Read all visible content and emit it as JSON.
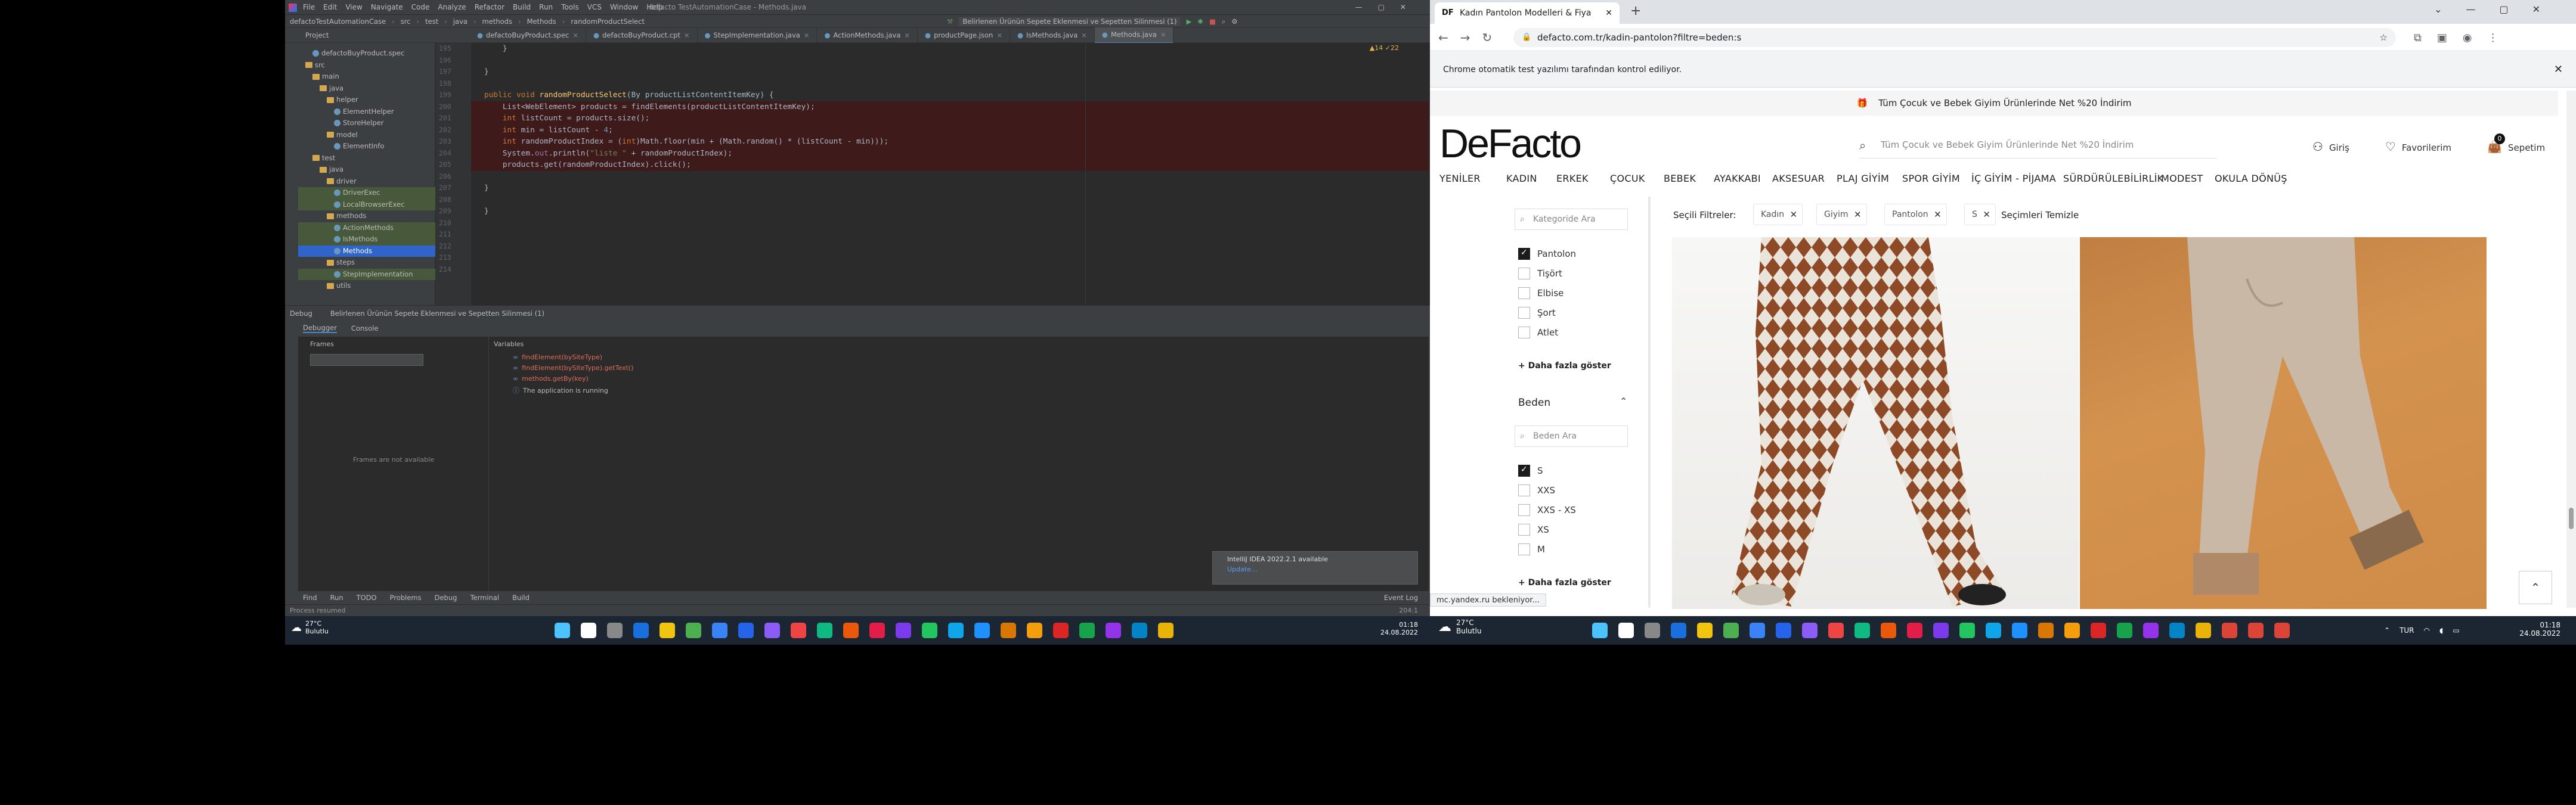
{
  "ide": {
    "menu": [
      "File",
      "Edit",
      "View",
      "Navigate",
      "Code",
      "Analyze",
      "Refactor",
      "Build",
      "Run",
      "Tools",
      "VCS",
      "Window",
      "Help"
    ],
    "window_title": "defacto TestAutomationCase - Methods.java",
    "breadcrumb": [
      "defactoTestAutomationCase",
      "src",
      "test",
      "java",
      "methods",
      "Methods",
      "randomProductSelect"
    ],
    "run_config": "Belirlenen Ürünün Sepete Eklenmesi ve Sepetten Silinmesi (1)",
    "tabs": [
      "defactoBuyProduct.spec",
      "defactoBuyProduct.cpt",
      "StepImplementation.java",
      "ActionMethods.java",
      "productPage.json",
      "IsMethods.java",
      "Methods.java"
    ],
    "project_label": "Project",
    "tree": [
      {
        "t": "defactoBuyProduct.spec",
        "d": 2,
        "i": "p"
      },
      {
        "t": "src",
        "d": 1,
        "i": "f"
      },
      {
        "t": "main",
        "d": 2,
        "i": "f"
      },
      {
        "t": "java",
        "d": 3,
        "i": "f"
      },
      {
        "t": "helper",
        "d": 4,
        "i": "f"
      },
      {
        "t": "ElementHelper",
        "d": 5,
        "i": "p"
      },
      {
        "t": "StoreHelper",
        "d": 5,
        "i": "p"
      },
      {
        "t": "model",
        "d": 4,
        "i": "f"
      },
      {
        "t": "ElementInfo",
        "d": 5,
        "i": "p"
      },
      {
        "t": "test",
        "d": 2,
        "i": "f"
      },
      {
        "t": "java",
        "d": 3,
        "i": "f"
      },
      {
        "t": "driver",
        "d": 4,
        "i": "f"
      },
      {
        "t": "DriverExec",
        "d": 5,
        "i": "p"
      },
      {
        "t": "LocalBrowserExec",
        "d": 5,
        "i": "p"
      },
      {
        "t": "methods",
        "d": 4,
        "i": "f"
      },
      {
        "t": "ActionMethods",
        "d": 5,
        "i": "p"
      },
      {
        "t": "IsMethods",
        "d": 5,
        "i": "p"
      },
      {
        "t": "Methods",
        "d": 5,
        "i": "p",
        "sel": true
      },
      {
        "t": "steps",
        "d": 4,
        "i": "f"
      },
      {
        "t": "StepImplementation",
        "d": 5,
        "i": "p"
      },
      {
        "t": "utils",
        "d": 4,
        "i": "f"
      }
    ],
    "line_numbers": [
      "195",
      "196",
      "197",
      "198",
      "199",
      "200",
      "201",
      "202",
      "203",
      "204",
      "205",
      "206",
      "207",
      "208",
      "209",
      "210",
      "211",
      "212",
      "213",
      "214"
    ],
    "code_lines": [
      "    }",
      "",
      "}",
      "",
      "public void randomProductSelect(By productListContentItemKey) {",
      "    List<WebElement> products = findElements(productListContentItemKey);",
      "    int listCount = products.size();",
      "    int min = listCount - 4;",
      "    int randomProductIndex = (int)Math.floor(min + (Math.random() * (listCount - min)));",
      "    System.out.println(\"liste \" + randomProductIndex);",
      "    products.get(randomProductIndex).click();",
      "",
      "}",
      "",
      "}",
      "",
      "",
      "",
      "",
      ""
    ],
    "warnings": "▲14 ✓22",
    "debug": {
      "title": "Debug",
      "config": "Belirlenen Ürünün Sepete Eklenmesi ve Sepetten Silinmesi (1)",
      "tabs": [
        "Debugger",
        "Console"
      ],
      "frames_label": "Frames",
      "variables_label": "Variables",
      "frames_empty": "Frames are not available",
      "variables": [
        "findElement(bySiteType)",
        "findElement(bySiteType).getText()",
        "methods.getBy(key)",
        "The application is running"
      ]
    },
    "notification": {
      "title": "IntelliJ IDEA 2022.2.1 available",
      "link": "Update..."
    },
    "status_tabs": [
      "Find",
      "Run",
      "TODO",
      "Problems",
      "Debug",
      "Terminal",
      "Build"
    ],
    "event_log": "Event Log",
    "status_msg": "Process resumed",
    "cursor_pos": "204:1"
  },
  "taskbar_left": {
    "temp": "27°C",
    "weather": "Bulutlu",
    "time": "01:18",
    "date": "24.08.2022"
  },
  "taskbar_right": {
    "temp": "27°C",
    "weather": "Bulutlu",
    "lang": "TUR",
    "time": "01:18",
    "date": "24.08.2022"
  },
  "browser": {
    "tab_title": "Kadın Pantolon Modelleri & Fiya",
    "url": "defacto.com.tr/kadin-pantolon?filtre=beden:s",
    "infobar": "Chrome otomatik test yazılımı tarafından kontrol ediliyor.",
    "promo": "Tüm Çocuk ve Bebek Giyim Ürünlerinde Net %20 İndirim",
    "logo": "DeFacto",
    "search_placeholder": "Tüm Çocuk ve Bebek Giyim Ürünlerinde Net %20 İndirim",
    "login": "Giriş",
    "favorites": "Favorilerim",
    "cart": "Sepetim",
    "cart_count": "0",
    "nav": [
      "YENİLER",
      "KADIN",
      "ERKEK",
      "ÇOCUK",
      "BEBEK",
      "AYAKKABI",
      "AKSESUAR",
      "PLAJ GİYİM",
      "SPOR GİYİM",
      "İÇ GİYİM - PİJAMA",
      "SÜRDÜRÜLEBİLİRLİK",
      "MODEST",
      "OKULA DÖNÜŞ"
    ],
    "category_search": "Kategoride Ara",
    "categories": [
      {
        "l": "Pantolon",
        "on": true
      },
      {
        "l": "Tişört",
        "on": false
      },
      {
        "l": "Elbise",
        "on": false
      },
      {
        "l": "Şort",
        "on": false
      },
      {
        "l": "Atlet",
        "on": false
      }
    ],
    "more": "+ Daha fazla göster",
    "size_title": "Beden",
    "size_search": "Beden Ara",
    "sizes": [
      {
        "l": "S",
        "on": true
      },
      {
        "l": "XXS",
        "on": false
      },
      {
        "l": "XXS - XS",
        "on": false
      },
      {
        "l": "XS",
        "on": false
      },
      {
        "l": "M",
        "on": false
      }
    ],
    "selected_label": "Seçili Filtreler:",
    "chips": [
      "Kadın",
      "Giyim",
      "Pantolon",
      "S"
    ],
    "clear": "Seçimleri Temizle",
    "status_url": "mc.yandex.ru bekleniyor..."
  }
}
